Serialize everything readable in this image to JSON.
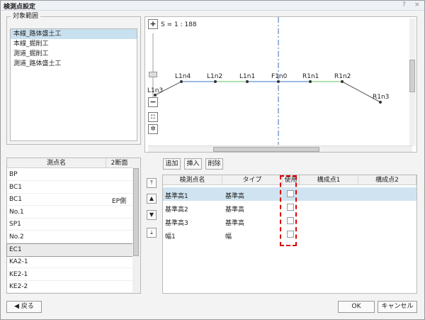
{
  "window": {
    "title": "検測点設定",
    "help": "?",
    "close": "×"
  },
  "range": {
    "label": "対象範囲",
    "items": [
      "本線_路体盛土工",
      "本線_掘削工",
      "測道_掘削工",
      "測道_路体盛土工"
    ]
  },
  "preview": {
    "scale": "S = 1 : 188",
    "points": [
      "L1n4",
      "L1n2",
      "L1n1",
      "F1n0",
      "R1n1",
      "R1n2",
      "L1n3",
      "R1n3"
    ]
  },
  "point_table": {
    "headers": [
      "測点名",
      "2断面"
    ],
    "rows": [
      [
        "BP",
        ""
      ],
      [
        "BC1",
        ""
      ],
      [
        "BC1",
        "EP側"
      ],
      [
        "No.1",
        ""
      ],
      [
        "SP1",
        ""
      ],
      [
        "No.2",
        ""
      ],
      [
        "EC1",
        ""
      ],
      [
        "KA2-1",
        ""
      ],
      [
        "KE2-1",
        ""
      ],
      [
        "KE2-2",
        ""
      ]
    ]
  },
  "actions": {
    "add": "追加",
    "insert": "挿入",
    "delete": "削除"
  },
  "check_table": {
    "headers": [
      "検測点名",
      "タイプ",
      "使用",
      "構成点1",
      "構成点2"
    ],
    "rows": [
      [
        "基準高1",
        "基準高"
      ],
      [
        "基準高2",
        "基準高"
      ],
      [
        "基準高3",
        "基準高"
      ],
      [
        "幅1",
        "幅"
      ]
    ]
  },
  "buttons": {
    "back": "◀ 戻る",
    "ok": "OK",
    "cancel": "キャンセル"
  }
}
